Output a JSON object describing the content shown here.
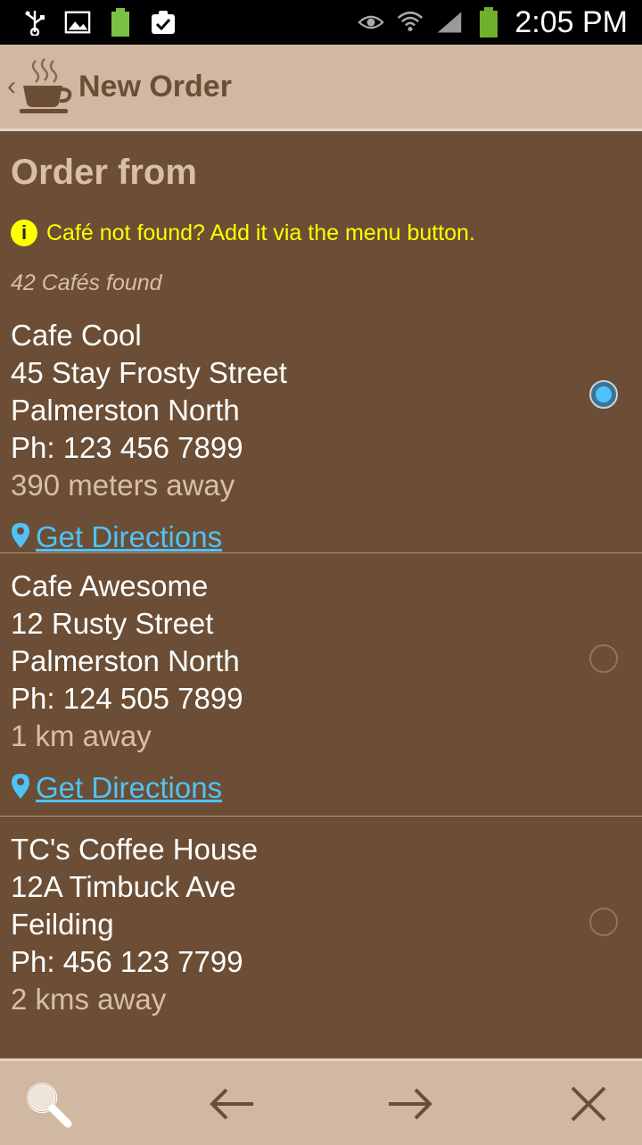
{
  "status_bar": {
    "time": "2:05 PM",
    "battery_small_label": "100%"
  },
  "action_bar": {
    "title": "New Order"
  },
  "main": {
    "section_title": "Order from",
    "info_text": "Café not found? Add it via the menu button.",
    "count_text": "42 Cafés found",
    "directions_label": "Get Directions",
    "cafes": [
      {
        "name": "Cafe Cool",
        "street": "45 Stay Frosty Street",
        "city": "Palmerston North",
        "phone": "Ph: 123 456 7899",
        "distance": "390 meters away",
        "selected": true
      },
      {
        "name": "Cafe Awesome",
        "street": "12 Rusty Street",
        "city": "Palmerston North",
        "phone": "Ph: 124 505 7899",
        "distance": "1 km away",
        "selected": false
      },
      {
        "name": "TC's Coffee House",
        "street": "12A Timbuck Ave",
        "city": "Feilding",
        "phone": "Ph: 456 123 7799",
        "distance": "2 kms away",
        "selected": false
      }
    ]
  },
  "bottom_bar": {
    "icons": [
      "search-icon",
      "arrow-left-icon",
      "arrow-right-icon",
      "close-icon"
    ]
  },
  "colors": {
    "background": "#6b4e35",
    "bar": "#d0b8a2",
    "accent_text": "#d8bfa6",
    "info": "#ffff00",
    "link": "#4fc3f7"
  }
}
